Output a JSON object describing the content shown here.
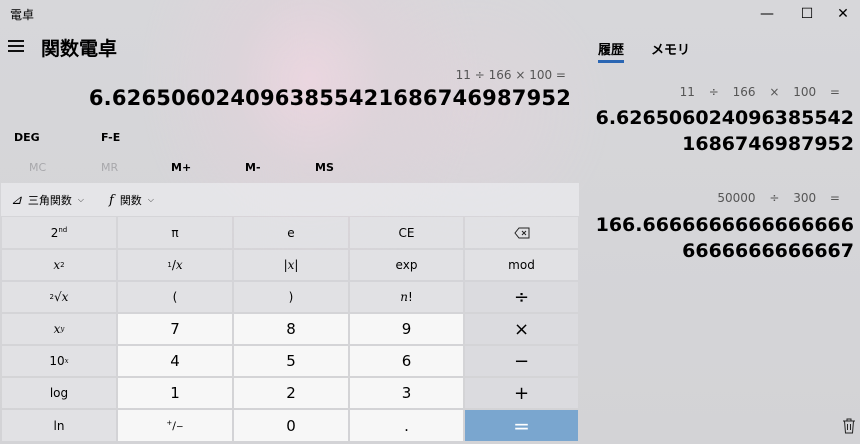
{
  "window": {
    "title": "電卓",
    "minimize": "—",
    "maximize": "☐",
    "close": "✕"
  },
  "header": {
    "mode_title": "関数電卓"
  },
  "display": {
    "expression": "11 ÷ 166 × 100 =",
    "result": "6.6265060240963855421686746987952"
  },
  "controls": {
    "angle": "DEG",
    "fe": "F-E"
  },
  "memory": {
    "mc": "MC",
    "mr": "MR",
    "mplus": "M+",
    "mminus": "M-",
    "ms": "MS"
  },
  "function_bar": {
    "trig_label": "三角関数",
    "func_label": "関数",
    "trig_icon": "⊿",
    "func_icon": "f",
    "chevron": "⌵"
  },
  "keys": {
    "second": "2nd",
    "pi": "π",
    "e": "e",
    "ce": "CE",
    "backspace": "⌫",
    "square": "x²",
    "reciprocal": "¹⁄x",
    "abs": "|x|",
    "exp": "exp",
    "mod": "mod",
    "sqrt": "²√x",
    "lparen": "(",
    "rparen": ")",
    "factorial": "n!",
    "divide": "÷",
    "power": "xʸ",
    "seven": "7",
    "eight": "8",
    "nine": "9",
    "multiply": "×",
    "tenpow": "10ˣ",
    "four": "4",
    "five": "5",
    "six": "6",
    "minus": "−",
    "log": "log",
    "one": "1",
    "two": "2",
    "three": "3",
    "plus": "+",
    "ln": "ln",
    "negate": "⁺⁄₋",
    "zero": "0",
    "decimal": ".",
    "equals": "="
  },
  "history": {
    "tab_history": "履歴",
    "tab_memory": "メモリ",
    "entries": [
      {
        "expression": "11 ÷ 166 × 100 =",
        "result": "6.6265060240963855421686746987952"
      },
      {
        "expression": "50000 ÷ 300 =",
        "result": "166.66666666666666666666666666667"
      }
    ]
  }
}
